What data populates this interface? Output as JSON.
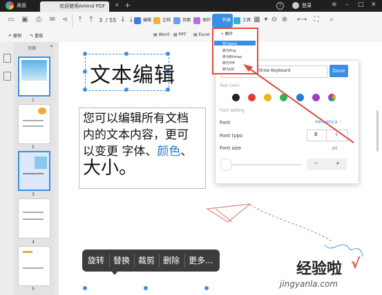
{
  "titlebar": {
    "app_name": "桌面",
    "tab_title": "欢迎使用Amind PDF",
    "login": "登录"
  },
  "toolbar": {
    "page_current": "3",
    "page_total": "/ 55",
    "edit": "编辑",
    "annotate": "注释",
    "page": "页面",
    "protect": "保护",
    "convert": "转换",
    "tools": "工具"
  },
  "row2": {
    "undo": "撤销",
    "redo": "重做",
    "word": "Word",
    "ppt": "PPT",
    "excel": "Excel"
  },
  "sidebar": {
    "header": "页面",
    "pages": [
      "1",
      "2",
      "3",
      "4",
      "5"
    ]
  },
  "convert_menu": {
    "title": "• 图片",
    "items": [
      "转为Jpeg",
      "转为Png",
      "转为Bitmap",
      "转为Tiff",
      "转为Gif"
    ]
  },
  "document": {
    "title_text": "文本编辑",
    "para_line1": "您可以编辑所有文档",
    "para_line2": "内的文本内容，更可",
    "para_line3a": "以变更 字体、",
    "para_line3b": "颜色",
    "para_line3c": "、",
    "para_line4": "大小。"
  },
  "format_panel": {
    "search_placeholder": "Show Keyboard",
    "done": "Done",
    "text_color_label": "Text color",
    "colors": [
      "#222222",
      "#e63a3a",
      "#f2b21c",
      "#33b44a",
      "#2a78d4",
      "#9b3fc6",
      "rainbow"
    ],
    "font_setting_label": "Font setting",
    "font_label": "Font",
    "font_value": "Helvetica",
    "font_type_label": "Font typo",
    "bold": "B",
    "italic": "I",
    "font_size_label": "Font size",
    "font_size_value": "pt",
    "minus": "−",
    "plus": "+"
  },
  "context_menu": {
    "items": [
      "旋转",
      "替换",
      "裁剪",
      "删除",
      "更多..."
    ]
  },
  "watermark": {
    "cn": "经验啦",
    "check": "√",
    "url": "jingyanla.com"
  }
}
